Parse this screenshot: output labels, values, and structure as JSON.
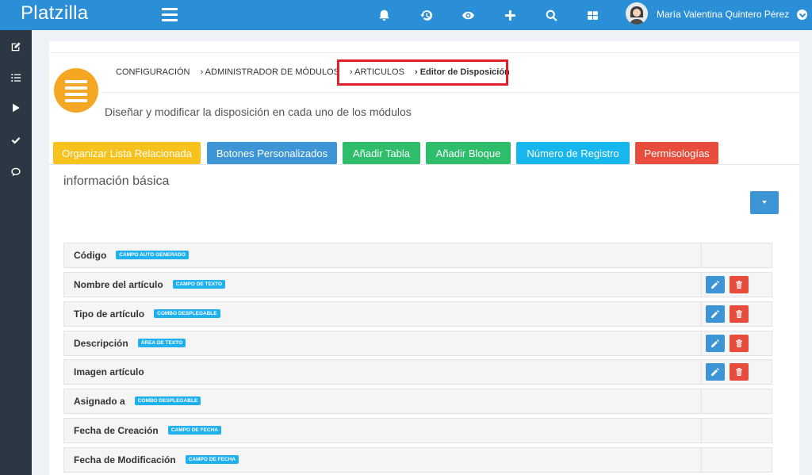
{
  "header": {
    "brand": "Platzilla",
    "user_name": "María Valentina Quintero Pérez",
    "icons": [
      "menu-icon",
      "bell-icon",
      "history-icon",
      "eye-icon",
      "plus-icon",
      "search-icon",
      "grid-icon",
      "user-avatar",
      "chevron-down-icon"
    ]
  },
  "sidebar": {
    "icons": [
      "edit-icon",
      "list-icon",
      "play-icon",
      "check-icon",
      "chat-icon"
    ]
  },
  "breadcrumb": {
    "items": [
      "CONFIGURACIÓN",
      "› ADMINISTRADOR DE MÓDULOS",
      "› ARTICULOS"
    ],
    "current": "› Editor de Disposición"
  },
  "page": {
    "subtitle": "Diseñar y modificar la disposición en cada uno de los módulos"
  },
  "actions": [
    {
      "label": "Organizar Lista Relacionada",
      "color": "#f7c21b"
    },
    {
      "label": "Botones Personalizados",
      "color": "#3d95d5"
    },
    {
      "label": "Añadir Tabla",
      "color": "#2ebd6b"
    },
    {
      "label": "Añadir Bloque",
      "color": "#2ebd6b"
    },
    {
      "label": "Número de Registro",
      "color": "#17b7ed"
    },
    {
      "label": "Permisologías",
      "color": "#e84c3d"
    }
  ],
  "section": {
    "title": "información básica"
  },
  "fields": [
    {
      "label": "Código",
      "tag": "CAMPO AUTO GENERADO",
      "editable": false
    },
    {
      "label": "Nombre del artículo",
      "tag": "CAMPO DE TEXTO",
      "editable": true
    },
    {
      "label": "Tipo de artículo",
      "tag": "COMBO DESPLEGABLE",
      "editable": true
    },
    {
      "label": "Descripción",
      "tag": "ÁREA DE TEXTO",
      "editable": true
    },
    {
      "label": "Imagen artículo",
      "tag": "",
      "editable": true
    },
    {
      "label": "Asignado a",
      "tag": "COMBO DESPLEGABLE",
      "editable": false
    },
    {
      "label": "Fecha de Creación",
      "tag": "CAMPO DE FECHA",
      "editable": false
    },
    {
      "label": "Fecha de Modificación",
      "tag": "CAMPO DE FECHA",
      "editable": false
    }
  ],
  "colors": {
    "topbar": "#2a8fd6",
    "sidebar": "#2b3743",
    "highlight": "#e0202a",
    "module_icon": "#f5a623",
    "tag": "#1fb0f0"
  }
}
